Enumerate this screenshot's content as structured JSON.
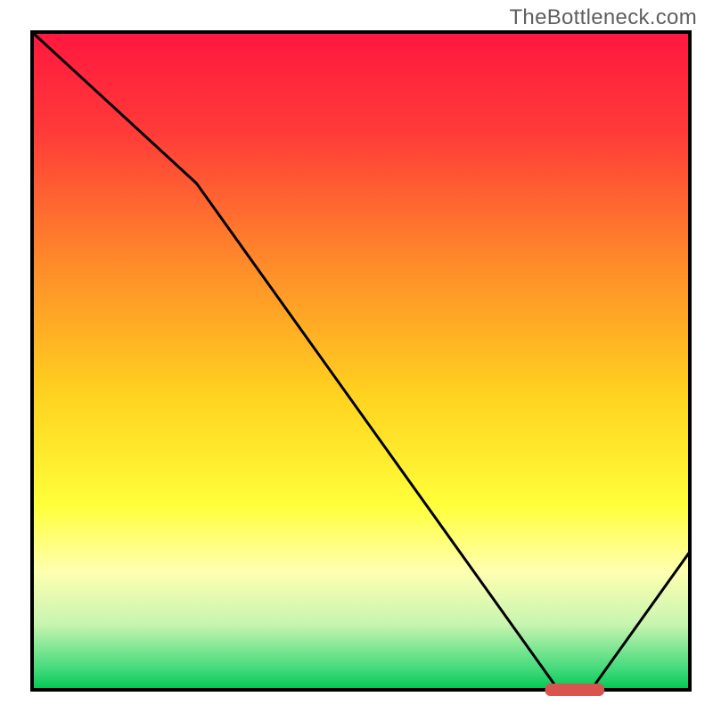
{
  "watermark": "TheBottleneck.com",
  "chart_data": {
    "type": "line",
    "title": "",
    "xlabel": "",
    "ylabel": "",
    "xlim": [
      0,
      100
    ],
    "ylim": [
      0,
      100
    ],
    "x": [
      0,
      25,
      80,
      85,
      100
    ],
    "y": [
      100,
      77,
      0,
      0,
      21
    ],
    "marker": {
      "x_start": 78,
      "x_end": 87,
      "y": 0,
      "color": "#d9534f"
    },
    "background_gradient": {
      "type": "vertical",
      "stops": [
        {
          "pos": 0.0,
          "color": "#ff173f"
        },
        {
          "pos": 0.15,
          "color": "#ff3a39"
        },
        {
          "pos": 0.35,
          "color": "#ff8a2a"
        },
        {
          "pos": 0.55,
          "color": "#ffd21f"
        },
        {
          "pos": 0.72,
          "color": "#ffff3a"
        },
        {
          "pos": 0.82,
          "color": "#ffffb0"
        },
        {
          "pos": 0.9,
          "color": "#c8f5b0"
        },
        {
          "pos": 0.97,
          "color": "#3fd97a"
        },
        {
          "pos": 1.0,
          "color": "#00c853"
        }
      ]
    },
    "frame_color": "#000000",
    "frame_width": 4,
    "curve_color": "#000000",
    "curve_width": 3
  }
}
